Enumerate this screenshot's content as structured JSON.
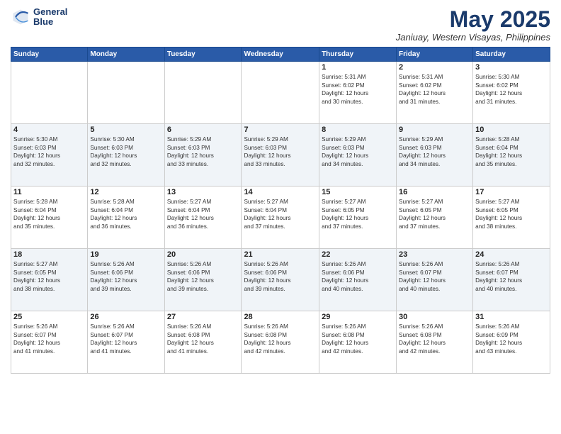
{
  "logo": {
    "line1": "General",
    "line2": "Blue"
  },
  "header": {
    "title": "May 2025",
    "location": "Janiuay, Western Visayas, Philippines"
  },
  "weekdays": [
    "Sunday",
    "Monday",
    "Tuesday",
    "Wednesday",
    "Thursday",
    "Friday",
    "Saturday"
  ],
  "weeks": [
    [
      {
        "day": "",
        "info": ""
      },
      {
        "day": "",
        "info": ""
      },
      {
        "day": "",
        "info": ""
      },
      {
        "day": "",
        "info": ""
      },
      {
        "day": "1",
        "info": "Sunrise: 5:31 AM\nSunset: 6:02 PM\nDaylight: 12 hours\nand 30 minutes."
      },
      {
        "day": "2",
        "info": "Sunrise: 5:31 AM\nSunset: 6:02 PM\nDaylight: 12 hours\nand 31 minutes."
      },
      {
        "day": "3",
        "info": "Sunrise: 5:30 AM\nSunset: 6:02 PM\nDaylight: 12 hours\nand 31 minutes."
      }
    ],
    [
      {
        "day": "4",
        "info": "Sunrise: 5:30 AM\nSunset: 6:03 PM\nDaylight: 12 hours\nand 32 minutes."
      },
      {
        "day": "5",
        "info": "Sunrise: 5:30 AM\nSunset: 6:03 PM\nDaylight: 12 hours\nand 32 minutes."
      },
      {
        "day": "6",
        "info": "Sunrise: 5:29 AM\nSunset: 6:03 PM\nDaylight: 12 hours\nand 33 minutes."
      },
      {
        "day": "7",
        "info": "Sunrise: 5:29 AM\nSunset: 6:03 PM\nDaylight: 12 hours\nand 33 minutes."
      },
      {
        "day": "8",
        "info": "Sunrise: 5:29 AM\nSunset: 6:03 PM\nDaylight: 12 hours\nand 34 minutes."
      },
      {
        "day": "9",
        "info": "Sunrise: 5:29 AM\nSunset: 6:03 PM\nDaylight: 12 hours\nand 34 minutes."
      },
      {
        "day": "10",
        "info": "Sunrise: 5:28 AM\nSunset: 6:04 PM\nDaylight: 12 hours\nand 35 minutes."
      }
    ],
    [
      {
        "day": "11",
        "info": "Sunrise: 5:28 AM\nSunset: 6:04 PM\nDaylight: 12 hours\nand 35 minutes."
      },
      {
        "day": "12",
        "info": "Sunrise: 5:28 AM\nSunset: 6:04 PM\nDaylight: 12 hours\nand 36 minutes."
      },
      {
        "day": "13",
        "info": "Sunrise: 5:27 AM\nSunset: 6:04 PM\nDaylight: 12 hours\nand 36 minutes."
      },
      {
        "day": "14",
        "info": "Sunrise: 5:27 AM\nSunset: 6:04 PM\nDaylight: 12 hours\nand 37 minutes."
      },
      {
        "day": "15",
        "info": "Sunrise: 5:27 AM\nSunset: 6:05 PM\nDaylight: 12 hours\nand 37 minutes."
      },
      {
        "day": "16",
        "info": "Sunrise: 5:27 AM\nSunset: 6:05 PM\nDaylight: 12 hours\nand 37 minutes."
      },
      {
        "day": "17",
        "info": "Sunrise: 5:27 AM\nSunset: 6:05 PM\nDaylight: 12 hours\nand 38 minutes."
      }
    ],
    [
      {
        "day": "18",
        "info": "Sunrise: 5:27 AM\nSunset: 6:05 PM\nDaylight: 12 hours\nand 38 minutes."
      },
      {
        "day": "19",
        "info": "Sunrise: 5:26 AM\nSunset: 6:06 PM\nDaylight: 12 hours\nand 39 minutes."
      },
      {
        "day": "20",
        "info": "Sunrise: 5:26 AM\nSunset: 6:06 PM\nDaylight: 12 hours\nand 39 minutes."
      },
      {
        "day": "21",
        "info": "Sunrise: 5:26 AM\nSunset: 6:06 PM\nDaylight: 12 hours\nand 39 minutes."
      },
      {
        "day": "22",
        "info": "Sunrise: 5:26 AM\nSunset: 6:06 PM\nDaylight: 12 hours\nand 40 minutes."
      },
      {
        "day": "23",
        "info": "Sunrise: 5:26 AM\nSunset: 6:07 PM\nDaylight: 12 hours\nand 40 minutes."
      },
      {
        "day": "24",
        "info": "Sunrise: 5:26 AM\nSunset: 6:07 PM\nDaylight: 12 hours\nand 40 minutes."
      }
    ],
    [
      {
        "day": "25",
        "info": "Sunrise: 5:26 AM\nSunset: 6:07 PM\nDaylight: 12 hours\nand 41 minutes."
      },
      {
        "day": "26",
        "info": "Sunrise: 5:26 AM\nSunset: 6:07 PM\nDaylight: 12 hours\nand 41 minutes."
      },
      {
        "day": "27",
        "info": "Sunrise: 5:26 AM\nSunset: 6:08 PM\nDaylight: 12 hours\nand 41 minutes."
      },
      {
        "day": "28",
        "info": "Sunrise: 5:26 AM\nSunset: 6:08 PM\nDaylight: 12 hours\nand 42 minutes."
      },
      {
        "day": "29",
        "info": "Sunrise: 5:26 AM\nSunset: 6:08 PM\nDaylight: 12 hours\nand 42 minutes."
      },
      {
        "day": "30",
        "info": "Sunrise: 5:26 AM\nSunset: 6:08 PM\nDaylight: 12 hours\nand 42 minutes."
      },
      {
        "day": "31",
        "info": "Sunrise: 5:26 AM\nSunset: 6:09 PM\nDaylight: 12 hours\nand 43 minutes."
      }
    ]
  ]
}
